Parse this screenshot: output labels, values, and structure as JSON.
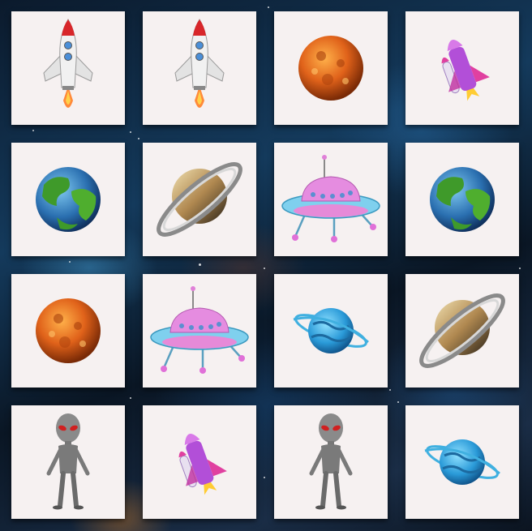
{
  "game": {
    "type": "memory-match",
    "rows": 4,
    "columns": 4,
    "cards": [
      [
        "rocket-icon",
        "rocket-icon",
        "orange-planet-icon",
        "space-shuttle-icon"
      ],
      [
        "earth-icon",
        "saturn-icon",
        "ufo-icon",
        "earth-icon"
      ],
      [
        "orange-planet-icon",
        "ufo-icon",
        "blue-ringed-planet-icon",
        "saturn-icon"
      ],
      [
        "alien-icon",
        "space-shuttle-icon",
        "alien-icon",
        "blue-ringed-planet-icon"
      ]
    ]
  },
  "colors": {
    "card_face": "#f6f1f1",
    "background": "#0b1a2c"
  }
}
